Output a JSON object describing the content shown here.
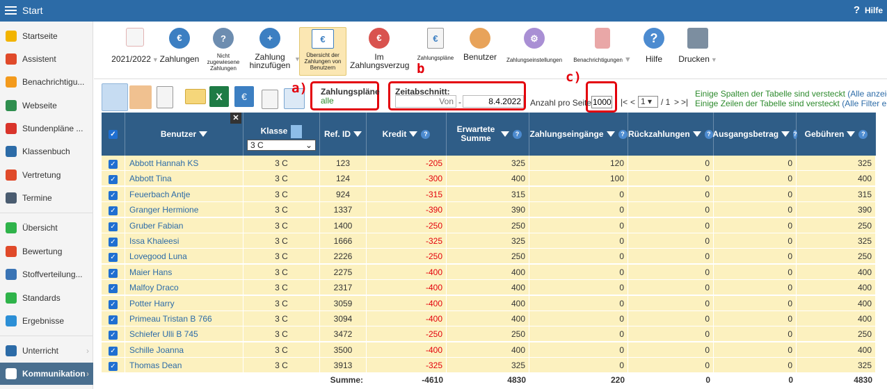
{
  "app": {
    "title": "Start",
    "help_label": "Hilfe"
  },
  "sidebar": {
    "items": [
      {
        "label": "Startseite",
        "color": "#f2b400"
      },
      {
        "label": "Assistent",
        "color": "#e04a2a"
      },
      {
        "label": "Benachrichtigu...",
        "color": "#f39a1c"
      },
      {
        "label": "Webseite",
        "color": "#2f8e4e"
      },
      {
        "label": "Stundenpläne ...",
        "color": "#d9342b"
      },
      {
        "label": "Klassenbuch",
        "color": "#2c6ba7"
      },
      {
        "label": "Vertretung",
        "color": "#e04a2a"
      },
      {
        "label": "Termine",
        "color": "#4a5c70"
      },
      {
        "label": "Übersicht",
        "color": "#2fb34a"
      },
      {
        "label": "Bewertung",
        "color": "#e04a2a"
      },
      {
        "label": "Stoffverteilung...",
        "color": "#3a74b5"
      },
      {
        "label": "Standards",
        "color": "#2fb34a"
      },
      {
        "label": "Ergebnisse",
        "color": "#2c8fd6"
      },
      {
        "label": "Unterricht",
        "color": "#2c6ba7"
      },
      {
        "label": "Kommunikation",
        "color": "#ffffff"
      }
    ]
  },
  "ribbon": {
    "year": "2021/2022",
    "zahlungen": "Zahlungen",
    "nicht_zugewiesen": "Nicht zugewiesene Zahlungen",
    "zahlung_hinzufuegen": "Zahlung hinzufügen",
    "uebersicht": "Übersicht der Zahlungen von Benutzern",
    "im_verzug": "Im Zahlungsverzug",
    "zahlungsplaene": "Zahlungspläne",
    "benutzer": "Benutzer",
    "einstellungen": "Zahlungseinstellungen",
    "benachrichtigungen": "Benachrichtigungen",
    "hilfe": "Hilfe",
    "drucken": "Drucken"
  },
  "filters": {
    "plans_label": "Zahlungspläne",
    "plans_value": "alle",
    "period_label": "Zeitabschnitt:",
    "from_placeholder": "Von",
    "to_value": "8.4.2022",
    "per_page_label": "Anzahl pro Seite:",
    "per_page_value": "1000",
    "page_value": "1",
    "page_total": "/ 1",
    "nav_first": "|<",
    "nav_prev": "<",
    "nav_next": ">",
    "nav_last": ">|",
    "note_columns": "Einige Spalten der Tabelle sind versteckt",
    "note_columns_link": "(Alle anzeigen",
    "note_rows": "Einige Zeilen der Tabelle sind versteckt",
    "note_rows_link": "(Alle Filter entf"
  },
  "annotations": {
    "a": "a)",
    "b": "b",
    "c": "c)"
  },
  "table": {
    "headers": {
      "benutzer": "Benutzer",
      "klasse": "Klasse",
      "klasse_filter": "3 C",
      "ref": "Ref. ID",
      "kredit": "Kredit",
      "erwartete": "Erwartete Summe",
      "eingaenge": "Zahlungseingänge",
      "rueck": "Rückzahlungen",
      "ausgang": "Ausgangsbetrag",
      "gebuehren": "Gebühren"
    },
    "rows": [
      {
        "name": "Abbott Hannah KS",
        "klasse": "3 C",
        "ref": "123",
        "kredit": "-205",
        "erwartet": "325",
        "eingang": "120",
        "rueck": "0",
        "ausgang": "0",
        "gebuehr": "325"
      },
      {
        "name": "Abbott Tina",
        "klasse": "3 C",
        "ref": "124",
        "kredit": "-300",
        "erwartet": "400",
        "eingang": "100",
        "rueck": "0",
        "ausgang": "0",
        "gebuehr": "400"
      },
      {
        "name": "Feuerbach Antje",
        "klasse": "3 C",
        "ref": "924",
        "kredit": "-315",
        "erwartet": "315",
        "eingang": "0",
        "rueck": "0",
        "ausgang": "0",
        "gebuehr": "315"
      },
      {
        "name": "Granger Hermione",
        "klasse": "3 C",
        "ref": "1337",
        "kredit": "-390",
        "erwartet": "390",
        "eingang": "0",
        "rueck": "0",
        "ausgang": "0",
        "gebuehr": "390"
      },
      {
        "name": "Gruber Fabian",
        "klasse": "3 C",
        "ref": "1400",
        "kredit": "-250",
        "erwartet": "250",
        "eingang": "0",
        "rueck": "0",
        "ausgang": "0",
        "gebuehr": "250"
      },
      {
        "name": "Issa Khaleesi",
        "klasse": "3 C",
        "ref": "1666",
        "kredit": "-325",
        "erwartet": "325",
        "eingang": "0",
        "rueck": "0",
        "ausgang": "0",
        "gebuehr": "325"
      },
      {
        "name": "Lovegood Luna",
        "klasse": "3 C",
        "ref": "2226",
        "kredit": "-250",
        "erwartet": "250",
        "eingang": "0",
        "rueck": "0",
        "ausgang": "0",
        "gebuehr": "250"
      },
      {
        "name": "Maier Hans",
        "klasse": "3 C",
        "ref": "2275",
        "kredit": "-400",
        "erwartet": "400",
        "eingang": "0",
        "rueck": "0",
        "ausgang": "0",
        "gebuehr": "400"
      },
      {
        "name": "Malfoy Draco",
        "klasse": "3 C",
        "ref": "2317",
        "kredit": "-400",
        "erwartet": "400",
        "eingang": "0",
        "rueck": "0",
        "ausgang": "0",
        "gebuehr": "400"
      },
      {
        "name": "Potter Harry",
        "klasse": "3 C",
        "ref": "3059",
        "kredit": "-400",
        "erwartet": "400",
        "eingang": "0",
        "rueck": "0",
        "ausgang": "0",
        "gebuehr": "400"
      },
      {
        "name": "Primeau Tristan B 766",
        "klasse": "3 C",
        "ref": "3094",
        "kredit": "-400",
        "erwartet": "400",
        "eingang": "0",
        "rueck": "0",
        "ausgang": "0",
        "gebuehr": "400"
      },
      {
        "name": "Schiefer Ulli B 745",
        "klasse": "3 C",
        "ref": "3472",
        "kredit": "-250",
        "erwartet": "250",
        "eingang": "0",
        "rueck": "0",
        "ausgang": "0",
        "gebuehr": "250"
      },
      {
        "name": "Schille Joanna",
        "klasse": "3 C",
        "ref": "3500",
        "kredit": "-400",
        "erwartet": "400",
        "eingang": "0",
        "rueck": "0",
        "ausgang": "0",
        "gebuehr": "400"
      },
      {
        "name": "Thomas Dean",
        "klasse": "3 C",
        "ref": "3913",
        "kredit": "-325",
        "erwartet": "325",
        "eingang": "0",
        "rueck": "0",
        "ausgang": "0",
        "gebuehr": "325"
      }
    ],
    "summary": {
      "label": "Summe:",
      "kredit": "-4610",
      "erwartet": "4830",
      "eingang": "220",
      "rueck": "0",
      "ausgang": "0",
      "gebuehr": "4830"
    }
  }
}
